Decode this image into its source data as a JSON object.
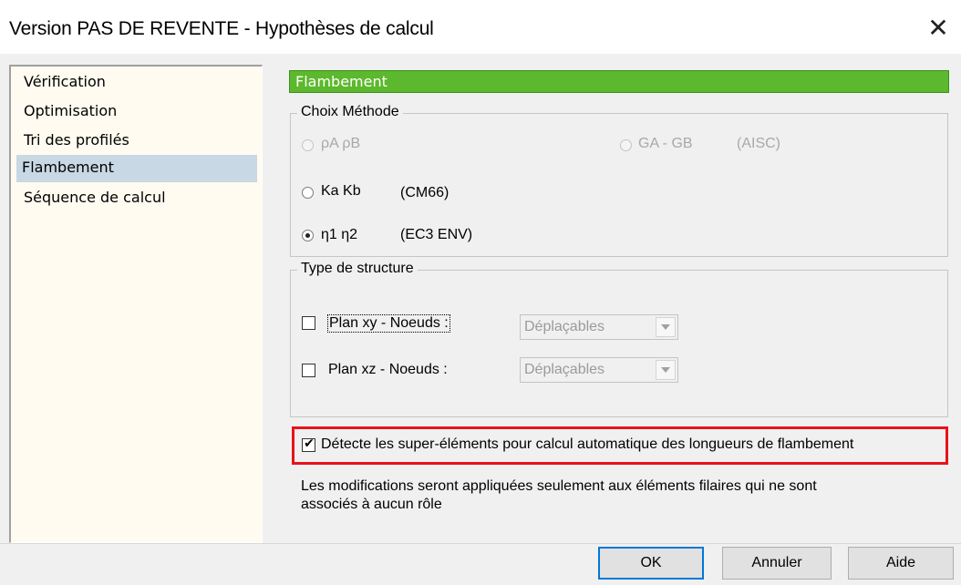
{
  "window": {
    "title": "Version PAS DE REVENTE - Hypothèses de calcul",
    "close_glyph": "✕"
  },
  "nav": {
    "items": [
      {
        "label": "Vérification"
      },
      {
        "label": "Optimisation"
      },
      {
        "label": "Tri des profilés"
      },
      {
        "label": "Flambement",
        "selected": true
      },
      {
        "label": "Séquence de calcul"
      }
    ]
  },
  "section": {
    "title": "Flambement"
  },
  "choix_methode": {
    "label": "Choix Méthode",
    "options": {
      "rho": {
        "label": "ρA ρB",
        "enabled": false
      },
      "ga_gb": {
        "label": "GA - GB",
        "note": "(AISC)",
        "enabled": false
      },
      "ka_kb": {
        "label": "Ka Kb",
        "note": "(CM66)",
        "enabled": true
      },
      "eta": {
        "label": "η1 η2",
        "note": "(EC3 ENV)",
        "enabled": true,
        "selected": true
      }
    }
  },
  "type_structure": {
    "label": "Type de structure",
    "plan_xy": {
      "label": "Plan xy - Noeuds :",
      "checked": false,
      "select_value": "Déplaçables"
    },
    "plan_xz": {
      "label": "Plan xz - Noeuds :",
      "checked": false,
      "select_value": "Déplaçables"
    }
  },
  "detect": {
    "label": "Détecte les super-éléments pour calcul automatique des longueurs de flambement",
    "checked": true
  },
  "note": {
    "line1": "Les modifications seront appliquées seulement aux éléments filaires qui ne sont",
    "line2": "associés à aucun rôle"
  },
  "buttons": {
    "ok": "OK",
    "cancel": "Annuler",
    "help": "Aide"
  },
  "colors": {
    "header_green": "#5cb82c",
    "highlight_red": "#e8121a",
    "selected_nav": "#c8d8e4"
  }
}
